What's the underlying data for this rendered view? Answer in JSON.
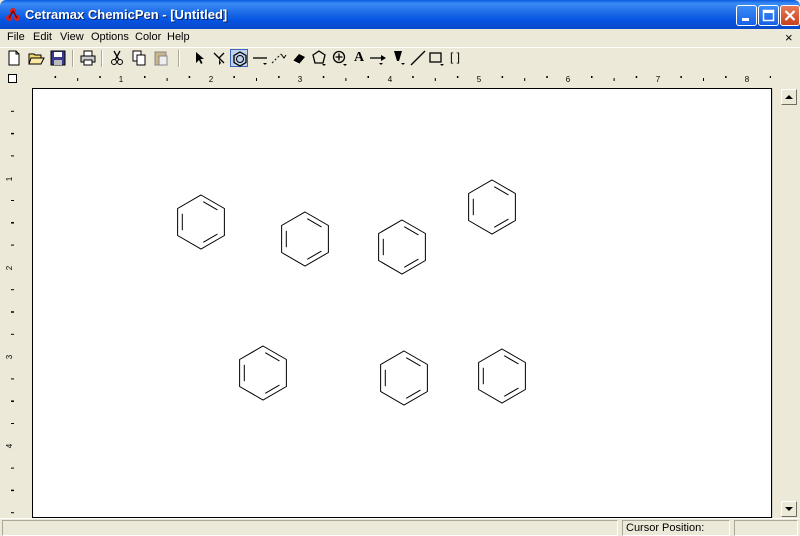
{
  "window": {
    "title": "Cetramax ChemicPen - [Untitled]",
    "titlebar_color": "#0a5be0"
  },
  "menu": {
    "items": [
      "File",
      "Edit",
      "View",
      "Options",
      "Color",
      "Help"
    ],
    "mdi_close": "×"
  },
  "toolbar": {
    "tools": [
      "new-icon",
      "open-icon",
      "save-icon",
      "print-icon",
      "cut-icon",
      "copy-icon",
      "paste-icon",
      "select-arrow-icon",
      "lasso-select-icon",
      "ring-tool-icon",
      "bond-tool-icon",
      "dashed-bond-icon",
      "eraser-icon",
      "polygon-icon",
      "charge-plus-icon",
      "text-tool-icon",
      "reaction-arrow-icon",
      "wedge-bond-icon",
      "line-tool-icon",
      "rectangle-tool-icon",
      "brackets-icon"
    ],
    "active_tool": "ring-tool-icon",
    "text_tool_label": "A",
    "brackets_label": "[ ]"
  },
  "rulers": {
    "horizontal_labels": [
      "1",
      "2",
      "3",
      "4",
      "5",
      "6",
      "7",
      "8"
    ],
    "vertical_labels": [
      "1",
      "2",
      "3",
      "4"
    ]
  },
  "canvas": {
    "molecules": [
      {
        "name": "benzene"
      },
      {
        "name": "benzene"
      },
      {
        "name": "benzene"
      },
      {
        "name": "benzene"
      },
      {
        "name": "benzene"
      },
      {
        "name": "benzene"
      },
      {
        "name": "benzene"
      }
    ]
  },
  "status": {
    "cursor_label": "Cursor Position:"
  }
}
